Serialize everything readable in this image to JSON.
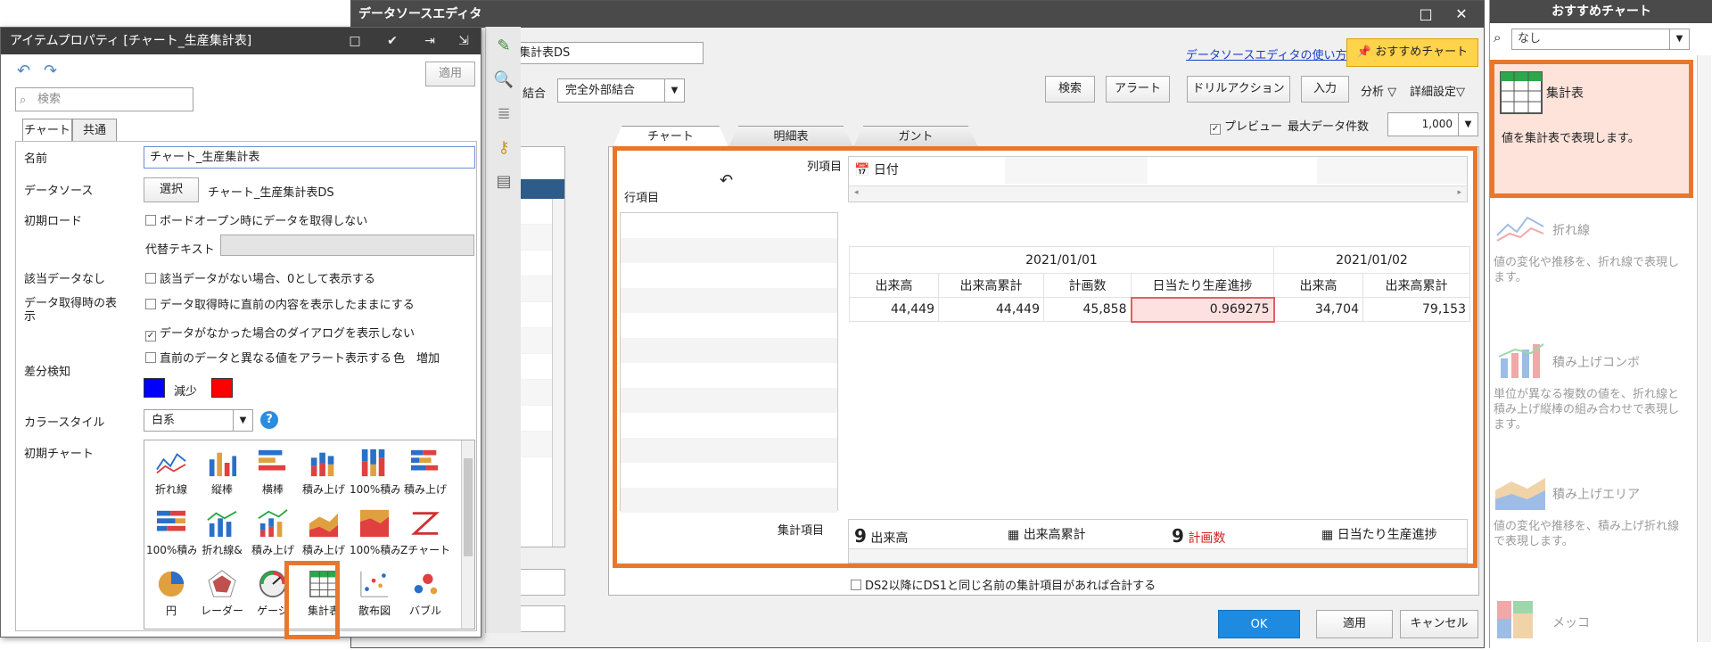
{
  "editor": {
    "title": "データソースエディタ",
    "ds_name": "集計表DS",
    "usage_link": "データソースエディタの使い方",
    "recommend_button": "おすすめチャート",
    "join_label": "結合",
    "join_value": "完全外部結合",
    "buttons": {
      "search": "検索",
      "alert": "アラート",
      "drill": "ドリルアクション",
      "input": "入力"
    },
    "analysis_label": "分析",
    "detail_label": "詳細設定",
    "preview_label": "プレビュー",
    "max_label": "最大データ件数",
    "max_value": "1,000",
    "tabs": [
      "チャート",
      "明細表",
      "ガント"
    ],
    "column_label": "列項目",
    "row_label": "行項目",
    "column_field": "日付",
    "agg_label": "集計項目",
    "agg_items": [
      "出来高",
      "出来高累計",
      "計画数",
      "日当たり生産進捗"
    ],
    "table": {
      "dates": [
        "2021/01/01",
        "2021/01/02"
      ],
      "headers": [
        "出来高",
        "出来高累計",
        "計画数",
        "日当たり生産進捗",
        "出来高",
        "出来高累計"
      ],
      "values": [
        "44,449",
        "44,449",
        "45,858",
        "0.969275",
        "34,704",
        "79,153"
      ]
    },
    "sum_checkbox": "DS2以降にDS1と同じ名前の集計項目があれば合計する",
    "ok": "OK",
    "apply": "適用",
    "cancel": "キャンセル"
  },
  "props": {
    "title": "アイテムプロパティ [チャート_生産集計表]",
    "apply": "適用",
    "search_placeholder": "検索",
    "tabs": [
      "チャート",
      "共通"
    ],
    "name_label": "名前",
    "name_value": "チャート_生産集計表",
    "ds_label": "データソース",
    "select_button": "選択",
    "ds_value": "チャート_生産集計表DS",
    "initload_label": "初期ロード",
    "initload_cb": "ボードオープン時にデータを取得しない",
    "alt_text_label": "代替テキスト",
    "nodata_label": "該当データなし",
    "nodata_cb": "該当データがない場合、0として表示する",
    "fetch_label_1": "データ取得時の表",
    "fetch_label_2": "示",
    "fetch_cb": "データ取得時に直前の内容を表示したままにする",
    "nodialog_cb": "データがなかった場合のダイアログを表示しない",
    "diff_cb": "直前のデータと異なる値をアラート表示する",
    "color_label": "色",
    "increase_label": "増加",
    "diff_label": "差分検知",
    "decrease_label": "減少",
    "colorstyle_label": "カラースタイル",
    "colorstyle_value": "白系",
    "initchart_label": "初期チャート",
    "chart_types": [
      "折れ線",
      "縦棒",
      "横棒",
      "積み上げ",
      "100%積み",
      "積み上げ",
      "100%積み",
      "折れ線&",
      "積み上げ",
      "積み上げ",
      "100%積み",
      "Zチャート",
      "円",
      "レーダー",
      "ゲージ",
      "集計表",
      "散布図",
      "バブル"
    ]
  },
  "recommend": {
    "title": "おすすめチャート",
    "filter_value": "なし",
    "cards": [
      {
        "name": "集計表",
        "desc": "値を集計表で表現します。"
      },
      {
        "name": "折れ線",
        "desc": "値の変化や推移を、折れ線で表現します。"
      },
      {
        "name": "積み上げコンボ",
        "desc": "単位が異なる複数の値を、折れ線と積み上げ縦棒の組み合わせで表現します。"
      },
      {
        "name": "積み上げエリア",
        "desc": "値の変化や推移を、積み上げ折れ線で表現します。"
      },
      {
        "name": "メッコ",
        "desc": ""
      }
    ]
  }
}
